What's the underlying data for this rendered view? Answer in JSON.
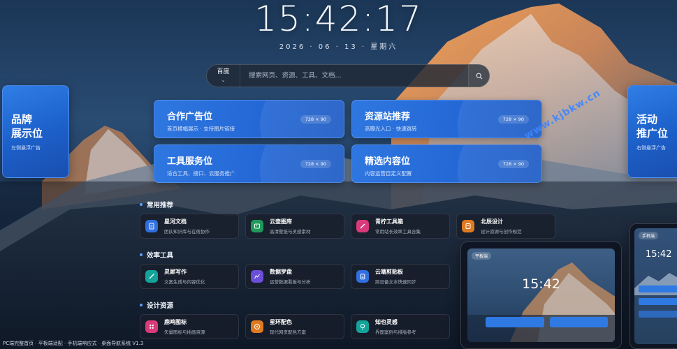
{
  "clock": {
    "time": "15:42:17",
    "date": "2026 · 06 · 13 · 星期六"
  },
  "search": {
    "engine": "百度",
    "engine_caret": "⌄",
    "placeholder": "搜索网页、资源、工具、文档..."
  },
  "side_ads": {
    "left": {
      "title_line1": "品牌",
      "title_line2": "展示位",
      "subtitle": "左侧悬浮广告"
    },
    "right": {
      "title_line1": "活动",
      "title_line2": "推广位",
      "subtitle": "右侧悬浮广告"
    }
  },
  "ads": [
    {
      "title": "合作广告位",
      "subtitle": "首页横幅展示 · 支持图片链接",
      "badge": "728 × 90"
    },
    {
      "title": "资源站推荐",
      "subtitle": "高曝光入口 · 快速跳转",
      "badge": "728 × 90"
    },
    {
      "title": "工具服务位",
      "subtitle": "适合工具、接口、云服务推广",
      "badge": "728 × 90"
    },
    {
      "title": "精选内容位",
      "subtitle": "内容运营自定义配置",
      "badge": "728 × 90"
    }
  ],
  "sections": [
    {
      "title": "常用推荐"
    },
    {
      "title": "效率工具"
    },
    {
      "title": "设计资源"
    }
  ],
  "tools": [
    {
      "name": "星河文档",
      "desc": "团队知识库与在线协作",
      "color": "#2f6fe0",
      "icon": "document-icon"
    },
    {
      "name": "云壶图库",
      "desc": "高清壁纸与灵感素材",
      "color": "#1f9a5a",
      "icon": "image-icon"
    },
    {
      "name": "青柠工具箱",
      "desc": "常用站长效率工具合集",
      "color": "#d93a7a",
      "icon": "pen-icon"
    },
    {
      "name": "北辰设计",
      "desc": "设计资源与创作规范",
      "color": "#e07a22",
      "icon": "note-icon"
    },
    {
      "name": "灵犀写作",
      "desc": "文案生成与内容优化",
      "color": "#14a39a",
      "icon": "wand-icon"
    },
    {
      "name": "数据罗盘",
      "desc": "运营数据看板与分析",
      "color": "#6b4fd8",
      "icon": "chart-icon"
    },
    {
      "name": "云端剪贴板",
      "desc": "跨设备文本快速同步",
      "color": "#2f6fe0",
      "icon": "clipboard-icon"
    },
    {
      "name": "鹿鸣图标",
      "desc": "矢量图标与插画资源",
      "color": "#d93a7a",
      "icon": "grid-icon"
    },
    {
      "name": "星环配色",
      "desc": "现代网页配色方案",
      "color": "#e07a22",
      "icon": "palette-icon"
    },
    {
      "name": "知也灵感",
      "desc": "界面案例与排版参考",
      "color": "#14a39a",
      "icon": "bulb-icon"
    }
  ],
  "devices": {
    "tablet": {
      "label": "平板端",
      "time": "15:42"
    },
    "phone": {
      "label": "手机端",
      "time": "15:42"
    }
  },
  "watermark": "www.kjbkw.cn",
  "footer": "PC端完整首页 · 平板端适配 · 手机端响应式 · 桌面导航系统 V1.3"
}
